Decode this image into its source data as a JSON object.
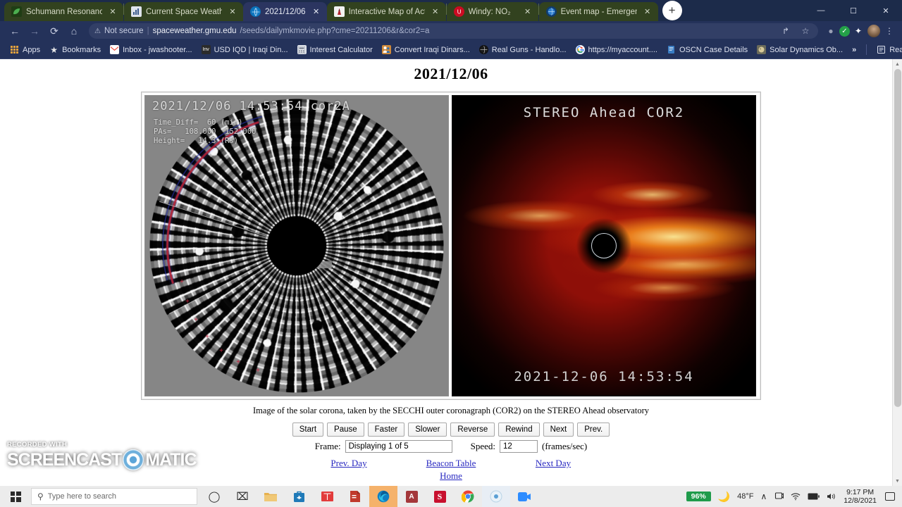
{
  "browser": {
    "tabs": [
      {
        "title": "Schumann Resonance Toda",
        "favicon": "leaf-icon",
        "active": false,
        "close_label": "✕"
      },
      {
        "title": "Current Space Weather - Sp",
        "favicon": "chart-icon",
        "active": false,
        "close_label": "✕"
      },
      {
        "title": "2021/12/06",
        "favicon": "globe-icon",
        "active": true,
        "close_label": "✕"
      },
      {
        "title": "Interactive Map of Active V",
        "favicon": "volcano-icon",
        "active": false,
        "close_label": "✕"
      },
      {
        "title": "Windy: NO₂",
        "favicon": "windy-icon",
        "active": false,
        "close_label": "✕"
      },
      {
        "title": "Event map - Emergency an",
        "favicon": "globe-blue-icon",
        "active": false,
        "close_label": "✕"
      }
    ],
    "new_tab_label": "+",
    "window_controls": {
      "minimize": "—",
      "maximize": "☐",
      "close": "✕"
    },
    "nav": {
      "back": "←",
      "forward": "→",
      "reload": "⟳",
      "home": "⌂"
    },
    "omnibox": {
      "security_icon": "⚠",
      "security_text": "Not secure",
      "separator": "|",
      "url_host": "spaceweather.gmu.edu",
      "url_path": "/seeds/dailymkmovie.php?cme=20211206&r&cor2=a",
      "share_icon": "↱",
      "bookmark_icon": "☆"
    },
    "toolbar_icons": [
      {
        "name": "extension-gray-icon",
        "glyph": "●",
        "color": "#9aa0b5"
      },
      {
        "name": "check-green-icon",
        "glyph": "✓",
        "color": "#24a148"
      },
      {
        "name": "puzzle-extensions-icon",
        "glyph": "✦",
        "color": "#ffffff"
      }
    ],
    "profile_avatar": "user-avatar",
    "menu_icon": "⋮"
  },
  "bookmarks": {
    "items": [
      {
        "label": "Apps",
        "icon": "apps-grid-icon"
      },
      {
        "label": "Bookmarks",
        "icon": "star-icon"
      },
      {
        "label": "Inbox - jwashooter...",
        "icon": "gmail-icon"
      },
      {
        "label": "USD IQD | Iraqi Din...",
        "icon": "investing-icon"
      },
      {
        "label": "Interest Calculator",
        "icon": "calculator-icon"
      },
      {
        "label": "Convert Iraqi Dinars...",
        "icon": "people-icon"
      },
      {
        "label": "Real Guns - Handlo...",
        "icon": "globe-dark-icon"
      },
      {
        "label": "https://myaccount....",
        "icon": "google-icon"
      },
      {
        "label": "OSCN Case Details",
        "icon": "document-icon"
      },
      {
        "label": "Solar Dynamics Ob...",
        "icon": "sun-icon"
      }
    ],
    "overflow_label": "»",
    "reading_list_label": "Reading list",
    "reading_list_icon": "list-icon"
  },
  "page": {
    "title": "2021/12/06",
    "left_image": {
      "header": "2021/12/06 14:53:54 cor2A",
      "meta_lines": [
        "Time_Diff=  60 (min)",
        "PAs=   108.000  152.000",
        "Height=   14.3 (Rs)"
      ]
    },
    "right_image": {
      "header": "STEREO Ahead COR2",
      "timestamp": "2021-12-06 14:53:54"
    },
    "caption": "Image of the solar corona, taken by the SECCHI outer coronagraph (COR2) on the STEREO Ahead observatory",
    "controls": [
      {
        "label": "Start",
        "name": "start-button"
      },
      {
        "label": "Pause",
        "name": "pause-button"
      },
      {
        "label": "Faster",
        "name": "faster-button"
      },
      {
        "label": "Slower",
        "name": "slower-button"
      },
      {
        "label": "Reverse",
        "name": "reverse-button"
      },
      {
        "label": "Rewind",
        "name": "rewind-button"
      },
      {
        "label": "Next",
        "name": "next-button"
      },
      {
        "label": "Prev.",
        "name": "prev-button"
      }
    ],
    "frame_label": "Frame:",
    "frame_value": "Displaying 1 of 5",
    "speed_label": "Speed:",
    "speed_value": "12",
    "speed_units": "(frames/sec)",
    "links": {
      "prev_day": "Prev. Day",
      "beacon_table": "Beacon Table",
      "next_day": "Next Day",
      "home": "Home"
    }
  },
  "watermark": {
    "top_line": "RECORDED WITH",
    "left_word": "SCREENCAST",
    "right_word": "MATIC"
  },
  "taskbar": {
    "search_placeholder": "Type here to search",
    "search_icon": "search-icon",
    "start_icon": "windows-logo-icon",
    "apps": [
      {
        "name": "cortana-icon",
        "glyph": "◯",
        "color": "#2b2b2b",
        "state": ""
      },
      {
        "name": "task-view-icon",
        "glyph": "⌸",
        "color": "#2b2b2b",
        "state": ""
      },
      {
        "name": "file-explorer-icon",
        "glyph": "🗀",
        "color": "#e8b45c",
        "state": ""
      },
      {
        "name": "store-icon",
        "glyph": "▣",
        "color": "#1f7ab8",
        "state": ""
      },
      {
        "name": "reader-icon",
        "glyph": "▤",
        "color": "#e23b3b",
        "state": ""
      },
      {
        "name": "pdf-icon",
        "glyph": "◨",
        "color": "#c0392b",
        "state": ""
      },
      {
        "name": "microsoft-edge-icon",
        "glyph": "◔",
        "color": "#2d8fd5",
        "state": "active"
      },
      {
        "name": "access-icon",
        "glyph": "A",
        "color": "#a4373a",
        "state": ""
      },
      {
        "name": "s-plus-icon",
        "glyph": "S",
        "color": "#c8102e",
        "state": ""
      },
      {
        "name": "google-chrome-icon",
        "glyph": "◉",
        "color": "#de4436",
        "state": ""
      },
      {
        "name": "recorder-icon",
        "glyph": "◉",
        "color": "#5a9fd4",
        "state": "active2"
      },
      {
        "name": "zoom-icon",
        "glyph": "▭",
        "color": "#2d8cff",
        "state": ""
      }
    ],
    "tray": {
      "battery_percent": "96%",
      "weather_icon": "moon-icon",
      "temperature": "48°F",
      "chevron": "∧",
      "icons": [
        {
          "name": "onedrive-icon",
          "glyph": "☁"
        },
        {
          "name": "wifi-icon",
          "glyph": "◢"
        },
        {
          "name": "battery-icon",
          "glyph": "▬"
        },
        {
          "name": "volume-icon",
          "glyph": "♦"
        }
      ],
      "time": "9:17 PM",
      "date": "12/8/2021",
      "notification_icon": "notification-icon"
    }
  }
}
